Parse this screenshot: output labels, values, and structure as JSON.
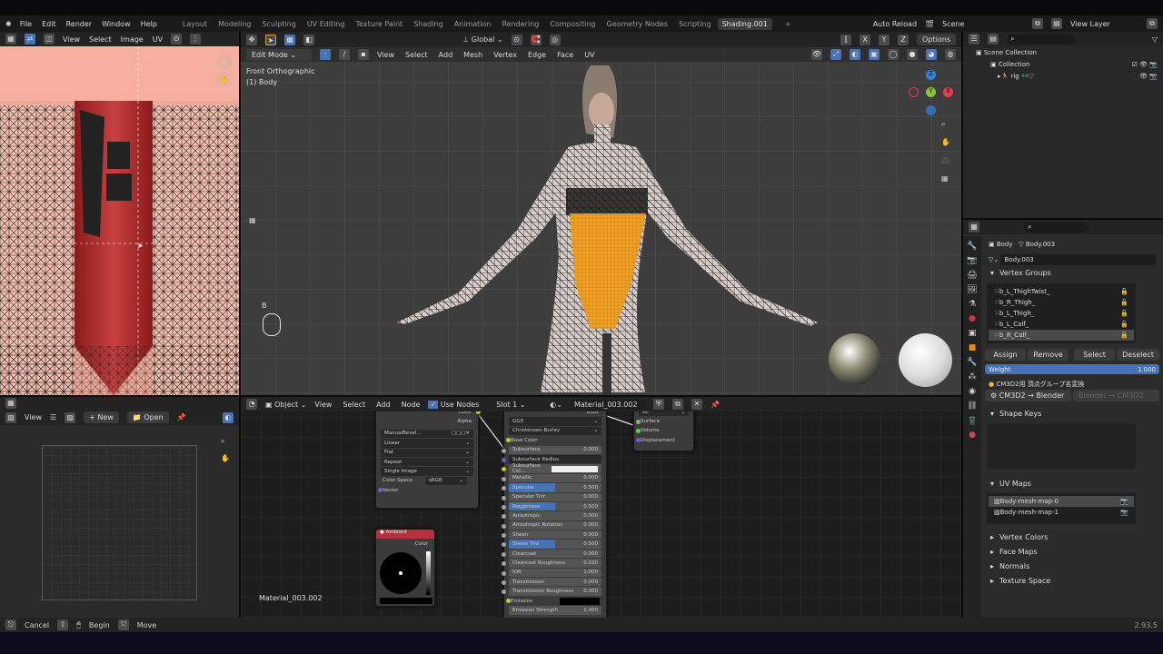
{
  "topbar": {
    "menus": [
      "File",
      "Edit",
      "Render",
      "Window",
      "Help"
    ],
    "workspaces": [
      "Layout",
      "Modeling",
      "Sculpting",
      "UV Editing",
      "Texture Paint",
      "Shading",
      "Animation",
      "Rendering",
      "Compositing",
      "Geometry Nodes",
      "Scripting",
      "Shading.001"
    ],
    "active_workspace": "Shading.001",
    "auto_reload": "Auto Reload",
    "scene": "Scene",
    "view_layer": "View Layer"
  },
  "image_editor": {
    "menus": [
      "View",
      "Select",
      "Image",
      "UV"
    ]
  },
  "viewport": {
    "mode": "Edit Mode",
    "menus": [
      "View",
      "Select",
      "Add",
      "Mesh",
      "Vertex",
      "Edge",
      "Face",
      "UV"
    ],
    "orientation": "Global",
    "axes": [
      "X",
      "Y",
      "Z"
    ],
    "options": "Options",
    "view_name": "Front Orthographic",
    "object_name": "(1) Body",
    "key_hint": "B",
    "gizmo": {
      "z": "Z",
      "y": "Y",
      "x": "X"
    }
  },
  "outliner": {
    "scene_collection": "Scene Collection",
    "collection": "Collection",
    "rig": "rig"
  },
  "properties": {
    "object": "Body",
    "mesh": "Body.003",
    "data_name": "Body.003",
    "vertex_groups_title": "Vertex Groups",
    "vertex_groups": [
      "b_L_ThighTwist_",
      "b_R_Thigh_",
      "b_L_Thigh_",
      "b_L_Calf_",
      "b_R_Calf_"
    ],
    "active_group": 4,
    "assign": "Assign",
    "remove": "Remove",
    "select": "Select",
    "deselect": "Deselect",
    "weight_label": "Weight",
    "weight_value": "1.000",
    "cm3d2_title": "CM3D2用 頂点グループ名変換",
    "cm3d2_to_blender": "CM3D2 → Blender",
    "blender_to_cm3d2": "Blender → CM3D2",
    "shape_keys": "Shape Keys",
    "uv_maps_title": "UV Maps",
    "uv_maps": [
      "Body-mesh-map-0",
      "Body-mesh-map-1"
    ],
    "collapsed": [
      "Vertex Colors",
      "Face Maps",
      "Normals",
      "Texture Space"
    ]
  },
  "image_browser": {
    "view": "View",
    "new": "New",
    "open": "Open"
  },
  "node_editor": {
    "object": "Object",
    "menus": [
      "View",
      "Select",
      "Add",
      "Node"
    ],
    "use_nodes": "Use Nodes",
    "slot": "Slot 1",
    "material": "Material_003.002",
    "material_label": "Material_003.002",
    "image_node": {
      "out_color": "Color",
      "out_alpha": "Alpha",
      "image": "ManualBevel...",
      "interp": "Linear",
      "proj": "Flat",
      "ext": "Repeat",
      "source": "Single Image",
      "cs_label": "Color Space",
      "cs": "sRGB",
      "vector": "Vector"
    },
    "bsdf": {
      "out": "BSDF",
      "dist": "GGX",
      "sss": "Christensen-Burley",
      "base_color": "Base Color",
      "rows": [
        {
          "l": "Subsurface",
          "v": "0.000"
        },
        {
          "l": "Subsurface Radius",
          "v": ""
        },
        {
          "l": "Subsurface Col...",
          "v": ""
        },
        {
          "l": "Metallic",
          "v": "0.000"
        },
        {
          "l": "Specular",
          "v": "0.500",
          "fill": 0.5
        },
        {
          "l": "Specular Tint",
          "v": "0.000"
        },
        {
          "l": "Roughness",
          "v": "0.500",
          "fill": 0.5
        },
        {
          "l": "Anisotropic",
          "v": "0.000"
        },
        {
          "l": "Anisotropic Rotation",
          "v": "0.000"
        },
        {
          "l": "Sheen",
          "v": "0.000"
        },
        {
          "l": "Sheen Tint",
          "v": "0.500",
          "fill": 0.5
        },
        {
          "l": "Clearcoat",
          "v": "0.000"
        },
        {
          "l": "Clearcoat Roughness",
          "v": "0.030"
        },
        {
          "l": "IOR",
          "v": "1.000"
        },
        {
          "l": "Transmission",
          "v": "0.000"
        },
        {
          "l": "Transmission Roughness",
          "v": "0.000"
        }
      ],
      "emission": "Emission",
      "emission_strength": "Emission Strength",
      "emission_strength_v": "1.000"
    },
    "output": {
      "target": "All",
      "surface": "Surface",
      "volume": "Volume",
      "displacement": "Displacement"
    },
    "ambient": {
      "title": "Ambient",
      "out": "Color"
    }
  },
  "statusbar": {
    "cancel": "Cancel",
    "begin": "Begin",
    "move": "Move",
    "version": "2.93.5"
  },
  "colors": {
    "accent": "#4772b3",
    "orange": "#f0a020",
    "ambient_header": "#b8303e"
  }
}
